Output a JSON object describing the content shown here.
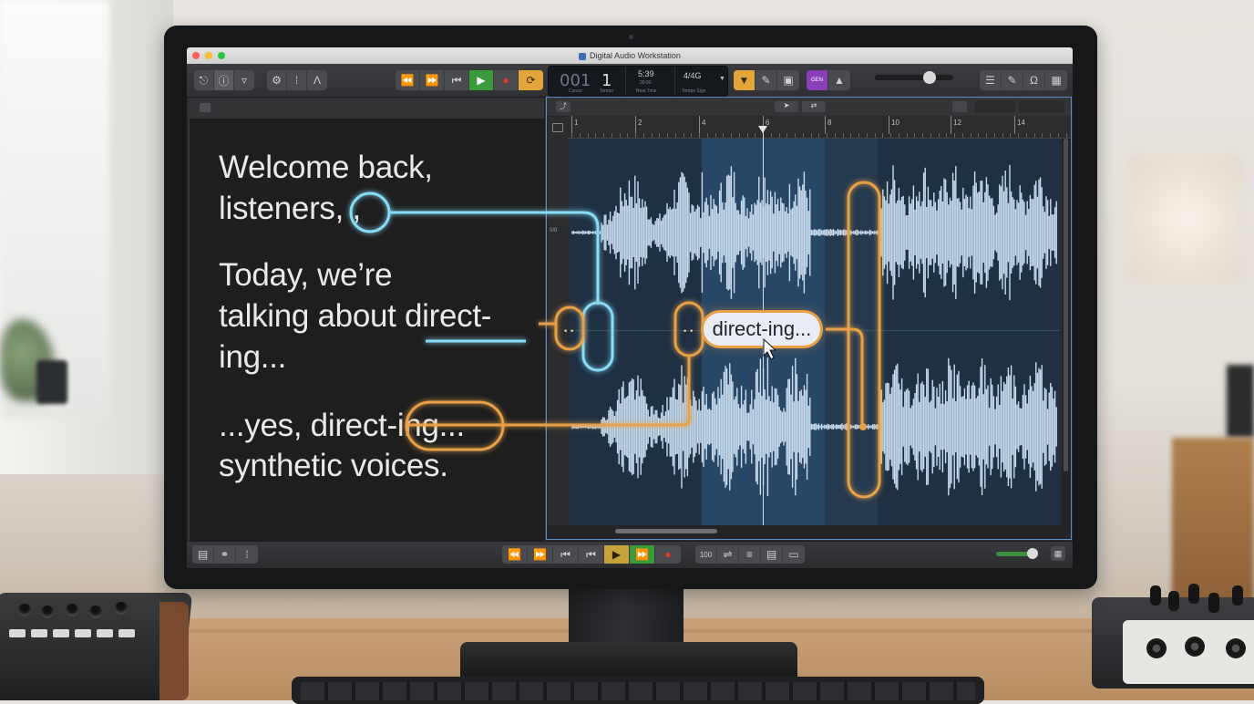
{
  "window": {
    "title": "Digital Audio Workstation"
  },
  "lcd": {
    "bar": "001",
    "beat": "1",
    "bar_label": "Cursor",
    "beat_label": "Tempo",
    "tempo": "5:39",
    "tempo_sub": "00:00",
    "tempo_label": "Beat Time",
    "key": "4/4G",
    "key_label": "Tempo Sign"
  },
  "toolbar": {
    "gen_label": "GEN"
  },
  "ruler": {
    "ticks": [
      "1",
      "2",
      "4",
      "6",
      "8",
      "10",
      "12",
      "14"
    ]
  },
  "track_label": "0/0",
  "lyrics": {
    "line1": "Welcome back,",
    "line2": "listeners, ,",
    "line3": "Today, we’re",
    "line4": "talking about direct-",
    "line5": "ing...",
    "line6": "...yes, direct-ing...",
    "line7": "synthetic voices."
  },
  "annotation": {
    "chip": "direct-ing...",
    "dots": "…"
  },
  "bottombar": {
    "counter": "100"
  },
  "colors": {
    "accent_orange": "#e8a046",
    "accent_cyan": "#7fd6f2",
    "waveform": "#c9dcef",
    "selection": "#5a8fcf"
  },
  "icons": [
    "library-icon",
    "info-icon",
    "smart-controls-icon",
    "settings-icon",
    "mixer-icon",
    "tuner-icon",
    "rewind-icon",
    "forward-icon",
    "go-to-start-icon",
    "play-icon",
    "record-icon",
    "cycle-icon",
    "metronome-icon",
    "pencil-icon",
    "note-pad-icon",
    "list-icon",
    "edit-icon",
    "loop-browser-icon",
    "media-browser-icon"
  ]
}
